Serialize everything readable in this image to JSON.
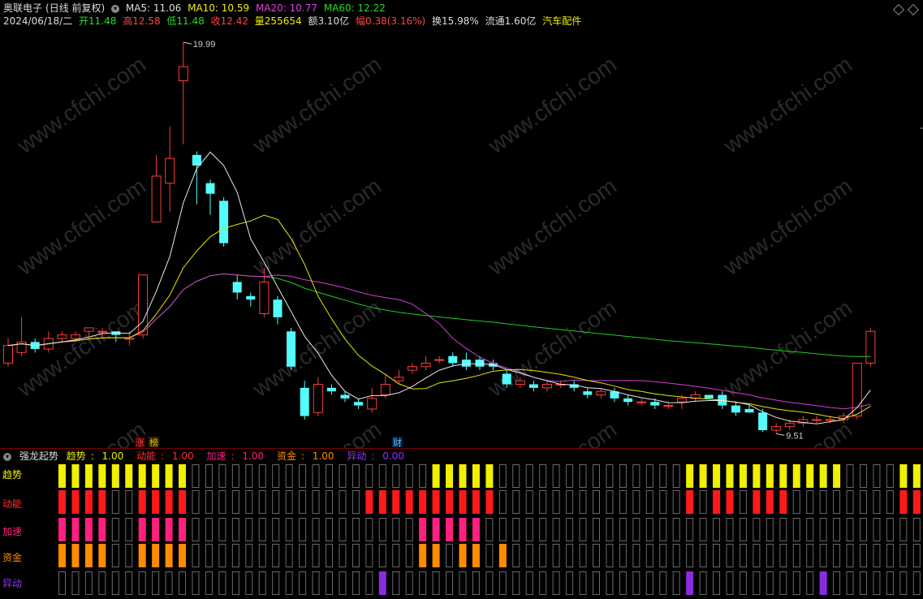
{
  "header": {
    "stock_name": "奥联电子",
    "adjust": "(日线 前复权)",
    "date": "2024/06/18/二",
    "ma5": "MA5: 11.06",
    "ma10": "MA10: 10.59",
    "ma20": "MA20: 10.77",
    "ma60": "MA60: 12.22",
    "open": "开11.48",
    "high": "高12.58",
    "low": "低11.48",
    "close": "收12.42",
    "volume": "量255654",
    "amount": "额3.10亿",
    "change": "幅0.38(3.16%)",
    "turnover": "换15.98%",
    "float": "流通1.60亿",
    "sector": "汽车配件"
  },
  "annotations": {
    "high_marker": "19.99",
    "low_marker": "9.51",
    "tag_zhang": "涨",
    "tag_bang": "榜",
    "tag_cai": "财"
  },
  "watermark": "www.cfchi.com",
  "indicator": {
    "name": "强龙起势",
    "values": [
      {
        "label": "趋势",
        "value": "1.00",
        "color": "#f0f000"
      },
      {
        "label": "动能",
        "value": "1.00",
        "color": "#ff3030"
      },
      {
        "label": "加速",
        "value": "1.00",
        "color": "#ff2080"
      },
      {
        "label": "资金",
        "value": "1.00",
        "color": "#ff8c00"
      },
      {
        "label": "异动",
        "value": "0.00",
        "color": "#9a30ff"
      }
    ],
    "rows": [
      {
        "label": "趋势",
        "color": "#f0f000",
        "on": [
          1,
          1,
          1,
          1,
          1,
          1,
          1,
          1,
          1,
          1,
          0,
          0,
          0,
          0,
          0,
          0,
          0,
          0,
          0,
          0,
          0,
          0,
          0,
          0,
          0,
          0,
          0,
          0,
          1,
          1,
          1,
          1,
          1,
          0,
          0,
          0,
          0,
          0,
          0,
          0,
          0,
          0,
          0,
          0,
          0,
          0,
          0,
          1,
          1,
          1,
          1,
          1,
          1,
          1,
          1,
          1,
          1,
          1,
          1,
          0,
          0,
          0,
          0,
          1,
          1,
          1,
          1
        ]
      },
      {
        "label": "动能",
        "color": "#ff1a1a",
        "on": [
          1,
          1,
          1,
          1,
          0,
          0,
          1,
          1,
          1,
          1,
          0,
          0,
          0,
          0,
          0,
          0,
          0,
          0,
          0,
          0,
          0,
          0,
          0,
          1,
          1,
          1,
          1,
          1,
          1,
          1,
          1,
          1,
          1,
          0,
          0,
          0,
          0,
          0,
          0,
          0,
          0,
          0,
          0,
          0,
          0,
          0,
          0,
          1,
          0,
          1,
          1,
          0,
          1,
          1,
          1,
          0,
          0,
          0,
          0,
          0,
          0,
          0,
          0,
          1,
          1,
          1,
          1
        ]
      },
      {
        "label": "加速",
        "color": "#ff2080",
        "on": [
          1,
          1,
          1,
          1,
          0,
          0,
          1,
          1,
          1,
          1,
          0,
          0,
          0,
          0,
          0,
          0,
          0,
          0,
          0,
          0,
          0,
          0,
          0,
          0,
          0,
          0,
          0,
          1,
          1,
          1,
          1,
          1,
          0,
          0,
          0,
          0,
          0,
          0,
          0,
          0,
          0,
          0,
          0,
          0,
          0,
          0,
          0,
          0,
          0,
          0,
          0,
          0,
          0,
          0,
          0,
          0,
          0,
          0,
          0,
          0,
          0,
          0,
          0,
          0,
          0,
          0,
          1
        ]
      },
      {
        "label": "资金",
        "color": "#ff8c00",
        "on": [
          1,
          1,
          1,
          1,
          0,
          0,
          1,
          1,
          1,
          1,
          0,
          0,
          0,
          0,
          0,
          0,
          0,
          0,
          0,
          0,
          0,
          0,
          0,
          0,
          0,
          0,
          0,
          1,
          1,
          0,
          1,
          1,
          0,
          1,
          0,
          0,
          0,
          0,
          0,
          0,
          0,
          0,
          0,
          0,
          0,
          0,
          0,
          0,
          0,
          0,
          0,
          0,
          0,
          0,
          0,
          0,
          0,
          0,
          0,
          0,
          0,
          0,
          0,
          0,
          0,
          1,
          1
        ]
      },
      {
        "label": "异动",
        "color": "#8a2be2",
        "on": [
          0,
          0,
          0,
          0,
          0,
          0,
          0,
          0,
          0,
          0,
          0,
          0,
          0,
          0,
          0,
          0,
          0,
          0,
          0,
          0,
          0,
          0,
          0,
          0,
          1,
          0,
          0,
          0,
          0,
          0,
          0,
          0,
          0,
          0,
          0,
          0,
          0,
          0,
          0,
          0,
          0,
          0,
          0,
          0,
          0,
          0,
          0,
          1,
          0,
          0,
          0,
          0,
          0,
          0,
          0,
          0,
          0,
          1,
          0,
          0,
          0,
          0,
          0,
          0,
          0,
          0,
          0
        ]
      }
    ]
  },
  "chart_data": {
    "type": "candlestick",
    "price_range": [
      9.0,
      20.5
    ],
    "candles": [
      [
        10.9,
        11.4,
        11.6,
        10.8
      ],
      [
        11.2,
        11.5,
        12.2,
        11.1
      ],
      [
        11.5,
        11.3,
        11.6,
        11.2
      ],
      [
        11.3,
        11.6,
        11.8,
        11.2
      ],
      [
        11.6,
        11.7,
        11.8,
        11.5
      ],
      [
        11.6,
        11.7,
        11.8,
        11.5
      ],
      [
        11.8,
        11.9,
        11.9,
        11.6
      ],
      [
        11.8,
        11.8,
        11.9,
        11.6
      ],
      [
        11.8,
        11.7,
        11.8,
        11.5
      ],
      [
        11.6,
        11.6,
        11.8,
        11.4
      ],
      [
        11.7,
        13.4,
        13.4,
        11.6
      ],
      [
        14.9,
        16.2,
        16.8,
        14.9
      ],
      [
        16.0,
        16.7,
        17.6,
        15.2
      ],
      [
        18.9,
        19.3,
        19.99,
        17.1
      ],
      [
        16.8,
        16.5,
        16.9,
        15.4
      ],
      [
        16.0,
        15.7,
        16.1,
        15.1
      ],
      [
        15.5,
        14.3,
        15.6,
        14.2
      ],
      [
        13.2,
        12.9,
        13.4,
        12.7
      ],
      [
        12.8,
        12.7,
        12.9,
        12.5
      ],
      [
        12.3,
        13.2,
        13.6,
        12.2
      ],
      [
        12.7,
        12.2,
        12.8,
        12.0
      ],
      [
        11.8,
        10.8,
        11.9,
        10.7
      ],
      [
        10.2,
        9.4,
        10.4,
        9.3
      ],
      [
        9.5,
        10.3,
        10.5,
        9.4
      ],
      [
        10.2,
        10.1,
        10.3,
        10.0
      ],
      [
        10.0,
        9.9,
        10.1,
        9.8
      ],
      [
        9.8,
        9.7,
        9.9,
        9.6
      ],
      [
        9.6,
        9.9,
        10.2,
        9.5
      ],
      [
        10.0,
        10.3,
        10.6,
        9.9
      ],
      [
        10.4,
        10.5,
        10.7,
        10.3
      ],
      [
        10.7,
        10.8,
        10.9,
        10.6
      ],
      [
        10.8,
        10.9,
        11.1,
        10.7
      ],
      [
        11.0,
        11.0,
        11.1,
        10.9
      ],
      [
        11.1,
        10.9,
        11.2,
        10.8
      ],
      [
        11.0,
        10.8,
        11.2,
        10.7
      ],
      [
        11.0,
        10.8,
        11.1,
        10.7
      ],
      [
        10.9,
        10.8,
        11.0,
        10.7
      ],
      [
        10.6,
        10.3,
        10.7,
        10.2
      ],
      [
        10.3,
        10.4,
        10.5,
        10.2
      ],
      [
        10.3,
        10.2,
        10.4,
        10.1
      ],
      [
        10.2,
        10.3,
        10.4,
        10.1
      ],
      [
        10.3,
        10.3,
        10.4,
        10.2
      ],
      [
        10.3,
        10.2,
        10.4,
        10.1
      ],
      [
        10.1,
        10.0,
        10.2,
        9.9
      ],
      [
        10.0,
        10.1,
        10.2,
        9.9
      ],
      [
        10.1,
        9.9,
        10.2,
        9.8
      ],
      [
        9.9,
        9.8,
        10.0,
        9.7
      ],
      [
        9.8,
        9.8,
        9.9,
        9.7
      ],
      [
        9.8,
        9.7,
        9.9,
        9.6
      ],
      [
        9.7,
        9.7,
        9.8,
        9.6
      ],
      [
        9.8,
        9.9,
        10.0,
        9.6
      ],
      [
        9.9,
        10.0,
        10.1,
        9.8
      ],
      [
        10.0,
        9.9,
        10.0,
        9.9
      ],
      [
        10.0,
        9.7,
        10.1,
        9.6
      ],
      [
        9.7,
        9.5,
        9.8,
        9.4
      ],
      [
        9.6,
        9.5,
        9.7,
        9.5
      ],
      [
        9.5,
        9.0,
        9.6,
        8.95
      ],
      [
        9.0,
        9.1,
        9.2,
        8.9
      ],
      [
        9.1,
        9.2,
        9.3,
        9.0
      ],
      [
        9.2,
        9.3,
        9.4,
        9.1
      ],
      [
        9.3,
        9.3,
        9.4,
        9.2
      ],
      [
        9.3,
        9.3,
        9.4,
        9.2
      ],
      [
        9.3,
        9.4,
        9.5,
        9.2
      ],
      [
        9.4,
        10.9,
        10.9,
        9.3
      ],
      [
        10.9,
        11.8,
        11.9,
        10.8
      ]
    ]
  }
}
